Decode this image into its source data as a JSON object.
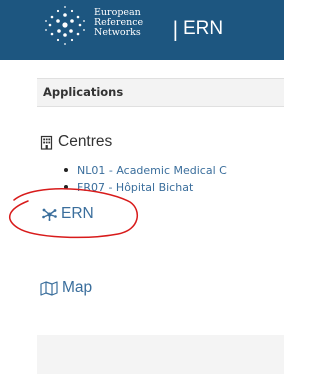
{
  "header": {
    "logo_icon": "ern-logo-icon",
    "logo_lines": [
      "European",
      "Reference",
      "Networks"
    ],
    "separator": "|",
    "title": "ERN",
    "background": "#1d5680"
  },
  "panel": {
    "title": "Applications",
    "centres": {
      "label": "Centres",
      "icon": "building-icon",
      "items": [
        "NL01 - Academic Medical C",
        "FR07 - Hôpital Bichat"
      ]
    },
    "ern": {
      "label": "ERN",
      "icon": "network-icon"
    },
    "map": {
      "label": "Map",
      "icon": "map-icon"
    }
  },
  "annotation": {
    "shape": "hand-drawn ellipse around ERN",
    "color": "#d81b1b"
  },
  "colors": {
    "link": "#3a6e9c",
    "header": "#1d5680",
    "panel_head": "#f3f3f3"
  }
}
